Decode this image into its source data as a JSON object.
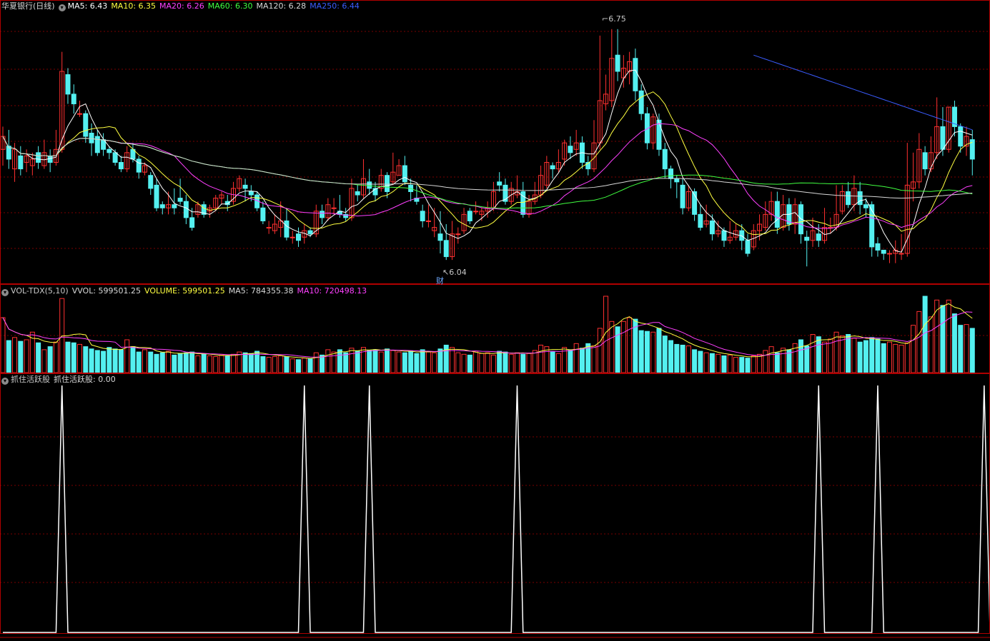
{
  "header": {
    "title": "华夏银行(日线)",
    "ma": [
      {
        "label": "MA5: 6.43",
        "color": "#ffffff"
      },
      {
        "label": "MA10: 6.35",
        "color": "#ffff40"
      },
      {
        "label": "MA20: 6.26",
        "color": "#ff40ff"
      },
      {
        "label": "MA60: 6.30",
        "color": "#40ff40"
      },
      {
        "label": "MA120: 6.28",
        "color": "#d8d8d8"
      },
      {
        "label": "MA250: 6.44",
        "color": "#3a5cff"
      }
    ],
    "collapse_icon": "chevron-down-icon"
  },
  "volume_legend": {
    "name": "VOL-TDX(5,10)",
    "items": [
      {
        "label": "VVOL: 599501.25",
        "color": "#d8d8d8"
      },
      {
        "label": "VOLUME: 599501.25",
        "color": "#ffff40"
      },
      {
        "label": "MA5: 784355.38",
        "color": "#d8d8d8"
      },
      {
        "label": "MA10: 720498.13",
        "color": "#ff40ff"
      }
    ]
  },
  "indicator_legend": {
    "name": "抓住活跃股",
    "items": [
      {
        "label": "抓住活跃股: 0.00",
        "color": "#d8d8d8"
      }
    ]
  },
  "annotations": {
    "high_label": "6.75",
    "low_label": "6.04",
    "marker": "财"
  },
  "colors": {
    "up": "#ff3030",
    "down": "#54f0f0",
    "grid": "#7a0000",
    "border": "#b00000",
    "signal": "#ffffff"
  },
  "chart_data": {
    "type": "candlestick",
    "price_range": [
      5.97,
      6.8
    ],
    "high_value": 6.75,
    "low_value": 6.04,
    "candles": [
      [
        6.38,
        6.42,
        6.45,
        6.33
      ],
      [
        6.39,
        6.35,
        6.44,
        6.32
      ],
      [
        6.32,
        6.38,
        6.4,
        6.28
      ],
      [
        6.36,
        6.32,
        6.39,
        6.3
      ],
      [
        6.34,
        6.36,
        6.38,
        6.31
      ],
      [
        6.33,
        6.35,
        6.37,
        6.3
      ],
      [
        6.37,
        6.34,
        6.39,
        6.32
      ],
      [
        6.33,
        6.37,
        6.41,
        6.32
      ],
      [
        6.36,
        6.34,
        6.38,
        6.31
      ],
      [
        6.34,
        6.38,
        6.44,
        6.33
      ],
      [
        6.38,
        6.62,
        6.68,
        6.37
      ],
      [
        6.61,
        6.55,
        6.63,
        6.52
      ],
      [
        6.55,
        6.52,
        6.58,
        6.49
      ],
      [
        6.49,
        6.49,
        6.53,
        6.48
      ],
      [
        6.49,
        6.42,
        6.5,
        6.4
      ],
      [
        6.43,
        6.4,
        6.46,
        6.36
      ],
      [
        6.42,
        6.37,
        6.44,
        6.36
      ],
      [
        6.41,
        6.38,
        6.43,
        6.36
      ],
      [
        6.38,
        6.37,
        6.39,
        6.35
      ],
      [
        6.37,
        6.34,
        6.38,
        6.33
      ],
      [
        6.34,
        6.32,
        6.36,
        6.31
      ],
      [
        6.32,
        6.37,
        6.39,
        6.31
      ],
      [
        6.38,
        6.35,
        6.4,
        6.34
      ],
      [
        6.35,
        6.31,
        6.36,
        6.29
      ],
      [
        6.31,
        6.33,
        6.34,
        6.3
      ],
      [
        6.3,
        6.26,
        6.31,
        6.24
      ],
      [
        6.27,
        6.2,
        6.29,
        6.19
      ],
      [
        6.21,
        6.2,
        6.22,
        6.18
      ],
      [
        6.2,
        6.21,
        6.25,
        6.18
      ],
      [
        6.21,
        6.2,
        6.26,
        6.18
      ],
      [
        6.23,
        6.22,
        6.29,
        6.21
      ],
      [
        6.22,
        6.17,
        6.24,
        6.15
      ],
      [
        6.17,
        6.14,
        6.2,
        6.13
      ],
      [
        6.18,
        6.21,
        6.22,
        6.17
      ],
      [
        6.21,
        6.18,
        6.22,
        6.17
      ],
      [
        6.19,
        6.2,
        6.21,
        6.17
      ],
      [
        6.2,
        6.23,
        6.24,
        6.19
      ],
      [
        6.23,
        6.24,
        6.25,
        6.21
      ],
      [
        6.22,
        6.21,
        6.24,
        6.19
      ],
      [
        6.22,
        6.26,
        6.28,
        6.21
      ],
      [
        6.26,
        6.29,
        6.3,
        6.25
      ],
      [
        6.27,
        6.26,
        6.29,
        6.22
      ],
      [
        6.25,
        6.24,
        6.27,
        6.22
      ],
      [
        6.24,
        6.2,
        6.25,
        6.19
      ],
      [
        6.2,
        6.16,
        6.22,
        6.15
      ],
      [
        6.14,
        6.14,
        6.16,
        6.12
      ],
      [
        6.13,
        6.15,
        6.18,
        6.12
      ],
      [
        6.14,
        6.16,
        6.22,
        6.11
      ],
      [
        6.16,
        6.11,
        6.2,
        6.1
      ],
      [
        6.11,
        6.11,
        6.13,
        6.09
      ],
      [
        6.12,
        6.1,
        6.14,
        6.08
      ],
      [
        6.11,
        6.13,
        6.15,
        6.09
      ],
      [
        6.13,
        6.12,
        6.14,
        6.11
      ],
      [
        6.12,
        6.19,
        6.21,
        6.11
      ],
      [
        6.19,
        6.17,
        6.21,
        6.15
      ],
      [
        6.17,
        6.21,
        6.23,
        6.16
      ],
      [
        6.2,
        6.2,
        6.23,
        6.18
      ],
      [
        6.19,
        6.18,
        6.24,
        6.17
      ],
      [
        6.18,
        6.17,
        6.2,
        6.16
      ],
      [
        6.17,
        6.26,
        6.29,
        6.16
      ],
      [
        6.25,
        6.24,
        6.27,
        6.22
      ],
      [
        6.24,
        6.29,
        6.35,
        6.23
      ],
      [
        6.28,
        6.26,
        6.32,
        6.24
      ],
      [
        6.26,
        6.24,
        6.28,
        6.22
      ],
      [
        6.26,
        6.3,
        6.32,
        6.25
      ],
      [
        6.3,
        6.25,
        6.31,
        6.23
      ],
      [
        6.28,
        6.31,
        6.37,
        6.27
      ],
      [
        6.3,
        6.33,
        6.35,
        6.3
      ],
      [
        6.33,
        6.28,
        6.36,
        6.27
      ],
      [
        6.27,
        6.25,
        6.29,
        6.22
      ],
      [
        6.23,
        6.22,
        6.27,
        6.21
      ],
      [
        6.19,
        6.16,
        6.21,
        6.14
      ],
      [
        6.16,
        6.16,
        6.21,
        6.14
      ],
      [
        6.13,
        6.14,
        6.2,
        6.11
      ],
      [
        6.12,
        6.1,
        6.19,
        6.06
      ],
      [
        6.1,
        6.05,
        6.15,
        6.04
      ],
      [
        6.05,
        6.12,
        6.16,
        6.04
      ],
      [
        6.12,
        6.12,
        6.14,
        6.09
      ],
      [
        6.13,
        6.18,
        6.2,
        6.12
      ],
      [
        6.19,
        6.16,
        6.2,
        6.15
      ],
      [
        6.19,
        6.19,
        6.22,
        6.18
      ],
      [
        6.18,
        6.19,
        6.2,
        6.16
      ],
      [
        6.19,
        6.2,
        6.22,
        6.17
      ],
      [
        6.2,
        6.25,
        6.28,
        6.19
      ],
      [
        6.28,
        6.27,
        6.31,
        6.25
      ],
      [
        6.27,
        6.22,
        6.29,
        6.21
      ],
      [
        6.22,
        6.26,
        6.28,
        6.21
      ],
      [
        6.24,
        6.25,
        6.3,
        6.23
      ],
      [
        6.25,
        6.18,
        6.28,
        6.17
      ],
      [
        6.18,
        6.22,
        6.24,
        6.17
      ],
      [
        6.22,
        6.24,
        6.28,
        6.21
      ],
      [
        6.24,
        6.3,
        6.33,
        6.23
      ],
      [
        6.27,
        6.34,
        6.36,
        6.26
      ],
      [
        6.33,
        6.32,
        6.34,
        6.29
      ],
      [
        6.32,
        6.34,
        6.38,
        6.31
      ],
      [
        6.35,
        6.4,
        6.41,
        6.33
      ],
      [
        6.39,
        6.37,
        6.42,
        6.35
      ],
      [
        6.38,
        6.4,
        6.44,
        6.36
      ],
      [
        6.4,
        6.34,
        6.42,
        6.32
      ],
      [
        6.34,
        6.32,
        6.36,
        6.3
      ],
      [
        6.32,
        6.4,
        6.47,
        6.31
      ],
      [
        6.4,
        6.53,
        6.73,
        6.38
      ],
      [
        6.52,
        6.55,
        6.61,
        6.5
      ],
      [
        6.53,
        6.66,
        6.75,
        6.51
      ],
      [
        6.67,
        6.62,
        6.75,
        6.59
      ],
      [
        6.6,
        6.63,
        6.67,
        6.57
      ],
      [
        6.62,
        6.65,
        6.68,
        6.58
      ],
      [
        6.66,
        6.56,
        6.69,
        6.53
      ],
      [
        6.56,
        6.49,
        6.58,
        6.47
      ],
      [
        6.49,
        6.4,
        6.51,
        6.38
      ],
      [
        6.4,
        6.48,
        6.49,
        6.38
      ],
      [
        6.47,
        6.38,
        6.49,
        6.36
      ],
      [
        6.38,
        6.32,
        6.4,
        6.29
      ],
      [
        6.32,
        6.29,
        6.33,
        6.26
      ],
      [
        6.29,
        6.28,
        6.3,
        6.23
      ],
      [
        6.27,
        6.2,
        6.29,
        6.18
      ],
      [
        6.2,
        6.25,
        6.27,
        6.19
      ],
      [
        6.25,
        6.18,
        6.26,
        6.16
      ],
      [
        6.18,
        6.14,
        6.21,
        6.13
      ],
      [
        6.15,
        6.16,
        6.21,
        6.14
      ],
      [
        6.16,
        6.12,
        6.18,
        6.1
      ],
      [
        6.12,
        6.13,
        6.16,
        6.11
      ],
      [
        6.13,
        6.1,
        6.14,
        6.08
      ],
      [
        6.1,
        6.11,
        6.16,
        6.09
      ],
      [
        6.11,
        6.13,
        6.15,
        6.1
      ],
      [
        6.13,
        6.1,
        6.15,
        6.07
      ],
      [
        6.1,
        6.06,
        6.12,
        6.05
      ],
      [
        6.08,
        6.13,
        6.15,
        6.07
      ],
      [
        6.13,
        6.15,
        6.18,
        6.1
      ],
      [
        6.14,
        6.18,
        6.22,
        6.13
      ],
      [
        6.18,
        6.22,
        6.25,
        6.16
      ],
      [
        6.22,
        6.14,
        6.25,
        6.12
      ],
      [
        6.14,
        6.21,
        6.24,
        6.13
      ],
      [
        6.21,
        6.15,
        6.23,
        6.13
      ],
      [
        6.15,
        6.21,
        6.23,
        6.12
      ],
      [
        6.21,
        6.12,
        6.22,
        6.09
      ],
      [
        6.11,
        6.1,
        6.13,
        6.02
      ],
      [
        6.1,
        6.13,
        6.17,
        6.08
      ],
      [
        6.12,
        6.1,
        6.15,
        6.08
      ],
      [
        6.1,
        6.14,
        6.2,
        6.09
      ],
      [
        6.14,
        6.14,
        6.17,
        6.12
      ],
      [
        6.14,
        6.18,
        6.27,
        6.13
      ],
      [
        6.19,
        6.25,
        6.27,
        6.18
      ],
      [
        6.25,
        6.21,
        6.28,
        6.2
      ],
      [
        6.21,
        6.26,
        6.3,
        6.19
      ],
      [
        6.25,
        6.21,
        6.28,
        6.18
      ],
      [
        6.21,
        6.2,
        6.23,
        6.17
      ],
      [
        6.21,
        6.08,
        6.22,
        6.05
      ],
      [
        6.09,
        6.07,
        6.11,
        6.05
      ],
      [
        6.07,
        6.06,
        6.07,
        6.04
      ],
      [
        6.06,
        6.06,
        6.07,
        6.03
      ],
      [
        6.06,
        6.07,
        6.1,
        6.03
      ],
      [
        6.06,
        6.06,
        6.12,
        6.04
      ],
      [
        6.06,
        6.27,
        6.4,
        6.05
      ],
      [
        6.26,
        6.28,
        6.37,
        6.22
      ],
      [
        6.28,
        6.38,
        6.43,
        6.26
      ],
      [
        6.37,
        6.32,
        6.39,
        6.3
      ],
      [
        6.32,
        6.37,
        6.42,
        6.31
      ],
      [
        6.37,
        6.45,
        6.54,
        6.35
      ],
      [
        6.45,
        6.38,
        6.51,
        6.36
      ],
      [
        6.38,
        6.51,
        6.51,
        6.37
      ],
      [
        6.51,
        6.45,
        6.53,
        6.42
      ],
      [
        6.45,
        6.39,
        6.46,
        6.37
      ],
      [
        6.39,
        6.42,
        6.45,
        6.36
      ],
      [
        6.41,
        6.35,
        6.44,
        6.3
      ]
    ],
    "volume": [
      0.72,
      0.42,
      0.46,
      0.41,
      0.43,
      0.53,
      0.39,
      0.3,
      0.34,
      0.4,
      0.97,
      0.4,
      0.39,
      0.37,
      0.34,
      0.31,
      0.29,
      0.28,
      0.33,
      0.31,
      0.3,
      0.43,
      0.34,
      0.27,
      0.3,
      0.27,
      0.24,
      0.26,
      0.28,
      0.23,
      0.25,
      0.26,
      0.27,
      0.22,
      0.24,
      0.22,
      0.21,
      0.23,
      0.22,
      0.24,
      0.27,
      0.26,
      0.25,
      0.28,
      0.21,
      0.2,
      0.21,
      0.22,
      0.21,
      0.18,
      0.17,
      0.19,
      0.18,
      0.26,
      0.23,
      0.3,
      0.27,
      0.3,
      0.26,
      0.32,
      0.28,
      0.33,
      0.29,
      0.3,
      0.27,
      0.31,
      0.29,
      0.27,
      0.26,
      0.28,
      0.25,
      0.3,
      0.27,
      0.26,
      0.31,
      0.36,
      0.33,
      0.26,
      0.24,
      0.23,
      0.28,
      0.25,
      0.26,
      0.23,
      0.28,
      0.27,
      0.24,
      0.26,
      0.24,
      0.25,
      0.29,
      0.36,
      0.34,
      0.27,
      0.25,
      0.33,
      0.3,
      0.38,
      0.32,
      0.38,
      0.35,
      0.58,
      1.0,
      0.67,
      0.6,
      0.67,
      0.72,
      0.7,
      0.55,
      0.54,
      0.53,
      0.58,
      0.48,
      0.42,
      0.37,
      0.36,
      0.35,
      0.3,
      0.28,
      0.26,
      0.25,
      0.24,
      0.22,
      0.23,
      0.2,
      0.2,
      0.19,
      0.22,
      0.24,
      0.29,
      0.34,
      0.26,
      0.32,
      0.3,
      0.38,
      0.43,
      0.35,
      0.5,
      0.47,
      0.4,
      0.44,
      0.53,
      0.48,
      0.5,
      0.45,
      0.4,
      0.42,
      0.46,
      0.44,
      0.38,
      0.4,
      0.37,
      0.36,
      0.39,
      0.62,
      0.8,
      1.0,
      0.73,
      0.95,
      0.88,
      0.95,
      0.77,
      0.62,
      0.63,
      0.58
    ],
    "signal": [
      0,
      0,
      0,
      0,
      0,
      0,
      0,
      0,
      0,
      0,
      1,
      0,
      0,
      0,
      0,
      0,
      0,
      0,
      0,
      0,
      0,
      0,
      0,
      0,
      0,
      0,
      0,
      0,
      0,
      0,
      0,
      0,
      0,
      0,
      0,
      0,
      0,
      0,
      0,
      0,
      0,
      0,
      0,
      0,
      0,
      0,
      0,
      0,
      0,
      0,
      0,
      1,
      0,
      0,
      0,
      0,
      0,
      0,
      0,
      0,
      0,
      0,
      1,
      0,
      0,
      0,
      0,
      0,
      0,
      0,
      0,
      0,
      0,
      0,
      0,
      0,
      0,
      0,
      0,
      0,
      0,
      0,
      0,
      0,
      0,
      0,
      0,
      1,
      0,
      0,
      0,
      0,
      0,
      0,
      0,
      0,
      0,
      0,
      0,
      0,
      0,
      0,
      0,
      0,
      0,
      0,
      0,
      0,
      0,
      0,
      0,
      0,
      0,
      0,
      0,
      0,
      0,
      0,
      0,
      0,
      0,
      0,
      0,
      0,
      0,
      0,
      0,
      0,
      0,
      0,
      0,
      0,
      0,
      0,
      0,
      0,
      0,
      0,
      1,
      0,
      0,
      0,
      0,
      0,
      0,
      0,
      0,
      0,
      1,
      0,
      0,
      0,
      0,
      0,
      0,
      0,
      0,
      0,
      0,
      0,
      0,
      0,
      0,
      0,
      0,
      0,
      1,
      0,
      0,
      0,
      0,
      0,
      0,
      0,
      0,
      0,
      0,
      0,
      0,
      0
    ]
  }
}
